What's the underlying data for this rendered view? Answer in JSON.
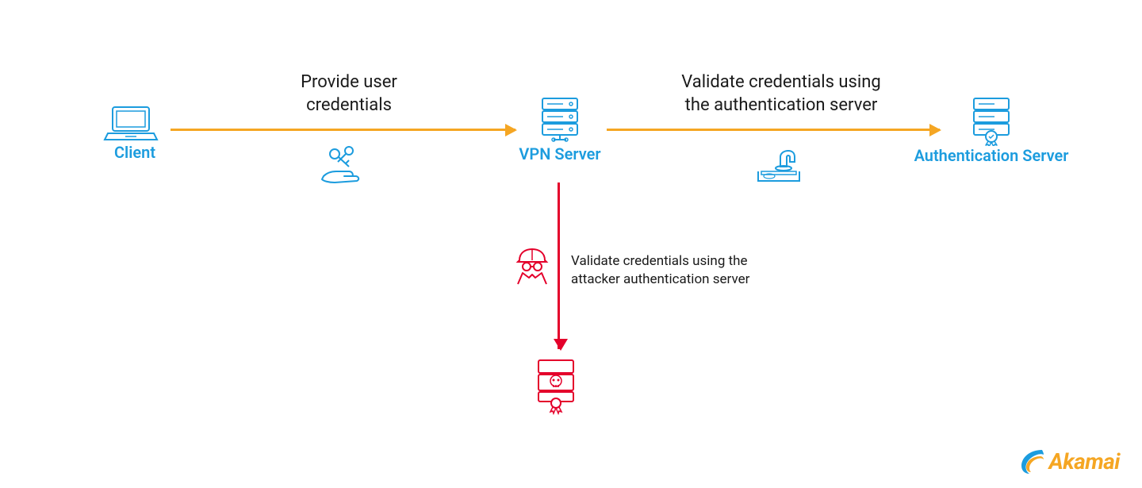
{
  "nodes": {
    "client_label": "Client",
    "vpn_label": "VPN Server",
    "auth_label": "Authentication Server"
  },
  "arrows": {
    "provide_line1": "Provide user",
    "provide_line2": "credentials",
    "validate_line1": "Validate credentials using",
    "validate_line2": "the authentication server"
  },
  "attack": {
    "line1": "Validate credentials using the",
    "line2": "attacker authentication server"
  },
  "logo": {
    "text": "Akamai"
  },
  "colors": {
    "blue": "#1c9cde",
    "orange": "#f5a623",
    "red": "#e4002b"
  }
}
